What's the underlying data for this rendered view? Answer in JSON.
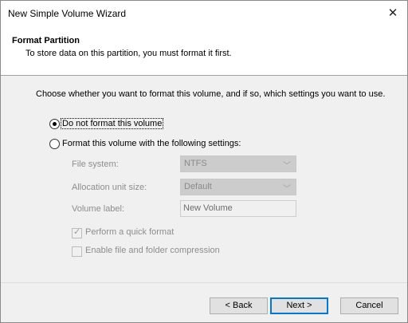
{
  "window": {
    "title": "New Simple Volume Wizard",
    "close_glyph": "✕"
  },
  "header": {
    "title": "Format Partition",
    "subtitle": "To store data on this partition, you must format it first."
  },
  "instructions": "Choose whether you want to format this volume, and if so, which settings you want to use.",
  "options": [
    {
      "label": "Do not format this volume",
      "selected": true
    },
    {
      "label": "Format this volume with the following settings:",
      "selected": false
    }
  ],
  "settings": {
    "file_system": {
      "label": "File system:",
      "value": "NTFS"
    },
    "allocation_unit_size": {
      "label": "Allocation unit size:",
      "value": "Default"
    },
    "volume_label": {
      "label": "Volume label:",
      "value": "New Volume"
    }
  },
  "checkboxes": [
    {
      "label": "Perform a quick format",
      "checked": true
    },
    {
      "label": "Enable file and folder compression",
      "checked": false
    }
  ],
  "buttons": {
    "back": "< Back",
    "next": "Next >",
    "cancel": "Cancel"
  },
  "icons": {
    "chevron": "chevron-down-icon",
    "close": "close-icon"
  },
  "colors": {
    "accent": "#0078d7",
    "disabled_text": "#8d8d8d"
  }
}
